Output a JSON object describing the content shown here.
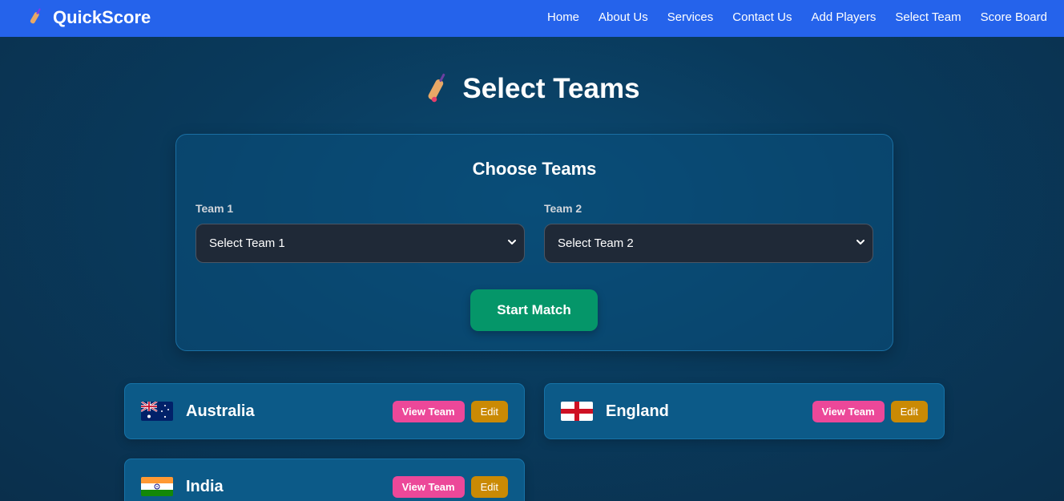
{
  "navbar": {
    "brand": "QuickScore",
    "brand_icon": "cricket-bat-icon",
    "links": [
      "Home",
      "About Us",
      "Services",
      "Contact Us",
      "Add Players",
      "Select Team",
      "Score Board"
    ],
    "bg_color": "#2563eb"
  },
  "page": {
    "title": "Select Teams",
    "title_icon": "cricket-bat-icon"
  },
  "choose": {
    "title": "Choose Teams",
    "team1_label": "Team 1",
    "team1_selected": "Select Team 1",
    "team2_label": "Team 2",
    "team2_selected": "Select Team 2",
    "start_button": "Start Match",
    "start_color": "#059669"
  },
  "teams": [
    {
      "name": "Australia",
      "flag": "australia-flag-icon",
      "view_label": "View Team",
      "edit_label": "Edit"
    },
    {
      "name": "England",
      "flag": "england-flag-icon",
      "view_label": "View Team",
      "edit_label": "Edit"
    },
    {
      "name": "India",
      "flag": "india-flag-icon",
      "view_label": "View Team",
      "edit_label": "Edit"
    }
  ],
  "colors": {
    "view_button": "#ec4899",
    "edit_button": "#ca8a04"
  }
}
